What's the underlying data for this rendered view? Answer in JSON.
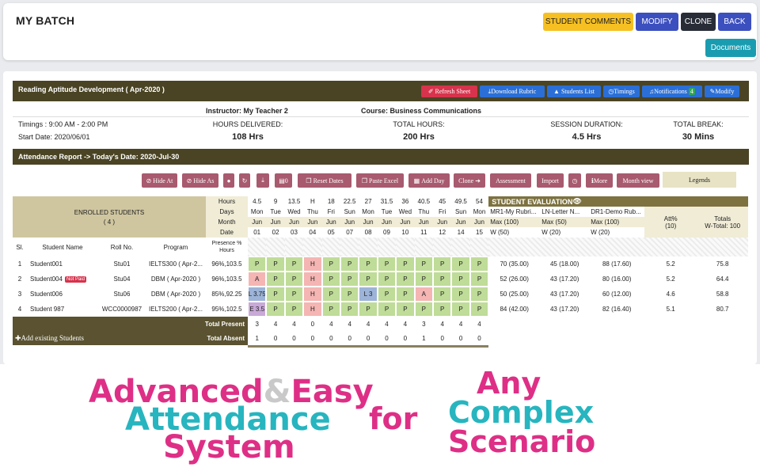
{
  "header": {
    "title": "MY BATCH",
    "buttons": {
      "comments": "STUDENT COMMENTS",
      "modify": "MODIFY",
      "clone": "CLONE",
      "back": "BACK",
      "documents": "Documents"
    }
  },
  "batch": {
    "title": "Reading Aptitude Development ( Apr-2020 )",
    "actions": [
      "Refresh Sheet",
      "Download Rubric",
      "Students List",
      "Timings",
      "Notifications",
      "Modify"
    ],
    "notifications_count": "4",
    "instructor": "Instructor: My Teacher 2",
    "course": "Course: Business Communications",
    "timings": "Timings : 9:00 AM - 2:00 PM",
    "start_date": "Start Date: 2020/06/01",
    "stats": [
      {
        "label": "HOURS DELIVERED:",
        "value": "108 Hrs"
      },
      {
        "label": "TOTAL HOURS:",
        "value": "200 Hrs"
      },
      {
        "label": "SESSION DURATION:",
        "value": "4.5 Hrs"
      },
      {
        "label": "TOTAL BREAK:",
        "value": "30 Mins"
      }
    ]
  },
  "attendance": {
    "title": "Attendance Report -> Today's Date: 2020-Jul-30",
    "toolbar": [
      "Hide At",
      "Hide As",
      "",
      "",
      "",
      "0",
      "Reset Dates",
      "Paste Excel",
      "Add Day",
      "Clone",
      "Assessment",
      "Import",
      "",
      "More",
      "Month view"
    ],
    "legends": "Legends",
    "enrolled_title": "ENROLLED STUDENTS",
    "enrolled_count": "( 4 )",
    "row_labels": [
      "Hours",
      "Days",
      "Month",
      "Date"
    ],
    "hours": [
      "4.5",
      "9",
      "13.5",
      "H",
      "18",
      "22.5",
      "27",
      "31.5",
      "36",
      "40.5",
      "45",
      "49.5",
      "54"
    ],
    "days": [
      "Mon",
      "Tue",
      "Wed",
      "Thu",
      "Fri",
      "Sun",
      "Mon",
      "Tue",
      "Wed",
      "Thu",
      "Fri",
      "Sun",
      "Mon"
    ],
    "months": [
      "Jun",
      "Jun",
      "Jun",
      "Jun",
      "Jun",
      "Jun",
      "Jun",
      "Jun",
      "Jun",
      "Jun",
      "Jun",
      "Jun",
      "Jun"
    ],
    "dates": [
      "01",
      "02",
      "03",
      "04",
      "05",
      "07",
      "08",
      "09",
      "10",
      "11",
      "12",
      "14",
      "15"
    ],
    "col_headers": {
      "sl": "Sl.",
      "name": "Student Name",
      "roll": "Roll No.",
      "program": "Program",
      "presence": "Presence % Hours"
    },
    "evaluation": {
      "title": "STUDENT EVALUATION",
      "columns": [
        {
          "name": "MR1-My Rubri...",
          "max": "Max (100)",
          "weight": "W (50)"
        },
        {
          "name": "LN-Letter N...",
          "max": "Max (50)",
          "weight": "W (20)"
        },
        {
          "name": "DR1-Demo Rub...",
          "max": "Max (100)",
          "weight": "W (20)"
        }
      ],
      "att_label": "Att%\n(10)",
      "totals_label": "Totals",
      "totals_sub": "W-Total: 100"
    },
    "students": [
      {
        "sl": "1",
        "name": "Student001",
        "badge": "",
        "roll": "Stu01",
        "program": "IELTS300 ( Apr-2...",
        "presence": "96%,103.5",
        "marks": [
          "P",
          "P",
          "P",
          "H",
          "P",
          "P",
          "P",
          "P",
          "P",
          "P",
          "P",
          "P",
          "P"
        ],
        "scores": [
          "70 (35.00)",
          "45 (18.00)",
          "88 (17.60)"
        ],
        "att": "5.2",
        "total": "75.8"
      },
      {
        "sl": "2",
        "name": "Student004",
        "badge": "Not Paid",
        "roll": "Stu04",
        "program": "DBM ( Apr-2020 )",
        "presence": "96%,103.5",
        "marks": [
          "A",
          "P",
          "P",
          "H",
          "P",
          "P",
          "P",
          "P",
          "P",
          "P",
          "P",
          "P",
          "P"
        ],
        "scores": [
          "52 (26.00)",
          "43 (17.20)",
          "80 (16.00)"
        ],
        "att": "5.2",
        "total": "64.4"
      },
      {
        "sl": "3",
        "name": "Student006",
        "badge": "",
        "roll": "Stu06",
        "program": "DBM ( Apr-2020 )",
        "presence": "85%,92.25",
        "marks": [
          "L 3.75",
          "P",
          "P",
          "H",
          "P",
          "P",
          "L 3",
          "P",
          "P",
          "A",
          "P",
          "P",
          "P"
        ],
        "scores": [
          "50 (25.00)",
          "43 (17.20)",
          "60 (12.00)"
        ],
        "att": "4.6",
        "total": "58.8"
      },
      {
        "sl": "4",
        "name": "Student 987",
        "badge": "",
        "roll": "WCC0000987",
        "program": "IELTS200 ( Apr-2...",
        "presence": "95%,102.5",
        "marks": [
          "E 3.5",
          "P",
          "P",
          "H",
          "P",
          "P",
          "P",
          "P",
          "P",
          "P",
          "P",
          "P",
          "P"
        ],
        "scores": [
          "84 (42.00)",
          "43 (17.20)",
          "82 (16.40)"
        ],
        "att": "5.1",
        "total": "80.7"
      }
    ],
    "total_present_label": "Total Present",
    "total_absent_label": "Total Absent",
    "total_present": [
      "3",
      "4",
      "4",
      "0",
      "4",
      "4",
      "4",
      "4",
      "4",
      "3",
      "4",
      "4",
      "4"
    ],
    "total_absent": [
      "1",
      "0",
      "0",
      "0",
      "0",
      "0",
      "0",
      "0",
      "0",
      "1",
      "0",
      "0",
      "0"
    ],
    "add_students": "Add existing Students"
  },
  "banner": {
    "line1a": "Advanced",
    "amp": "&",
    "line1b": "Easy",
    "line2": "Attendance",
    "line3": "System",
    "for": "for",
    "r1": "Any",
    "r2": "Complex",
    "r3": "Scenario"
  },
  "colors": {
    "accent_yellow": "#f6c022",
    "accent_blue": "#3c4fbf",
    "dark_olive": "#4a4424",
    "brand_pink": "#de2f86",
    "brand_teal": "#27b5bf"
  }
}
